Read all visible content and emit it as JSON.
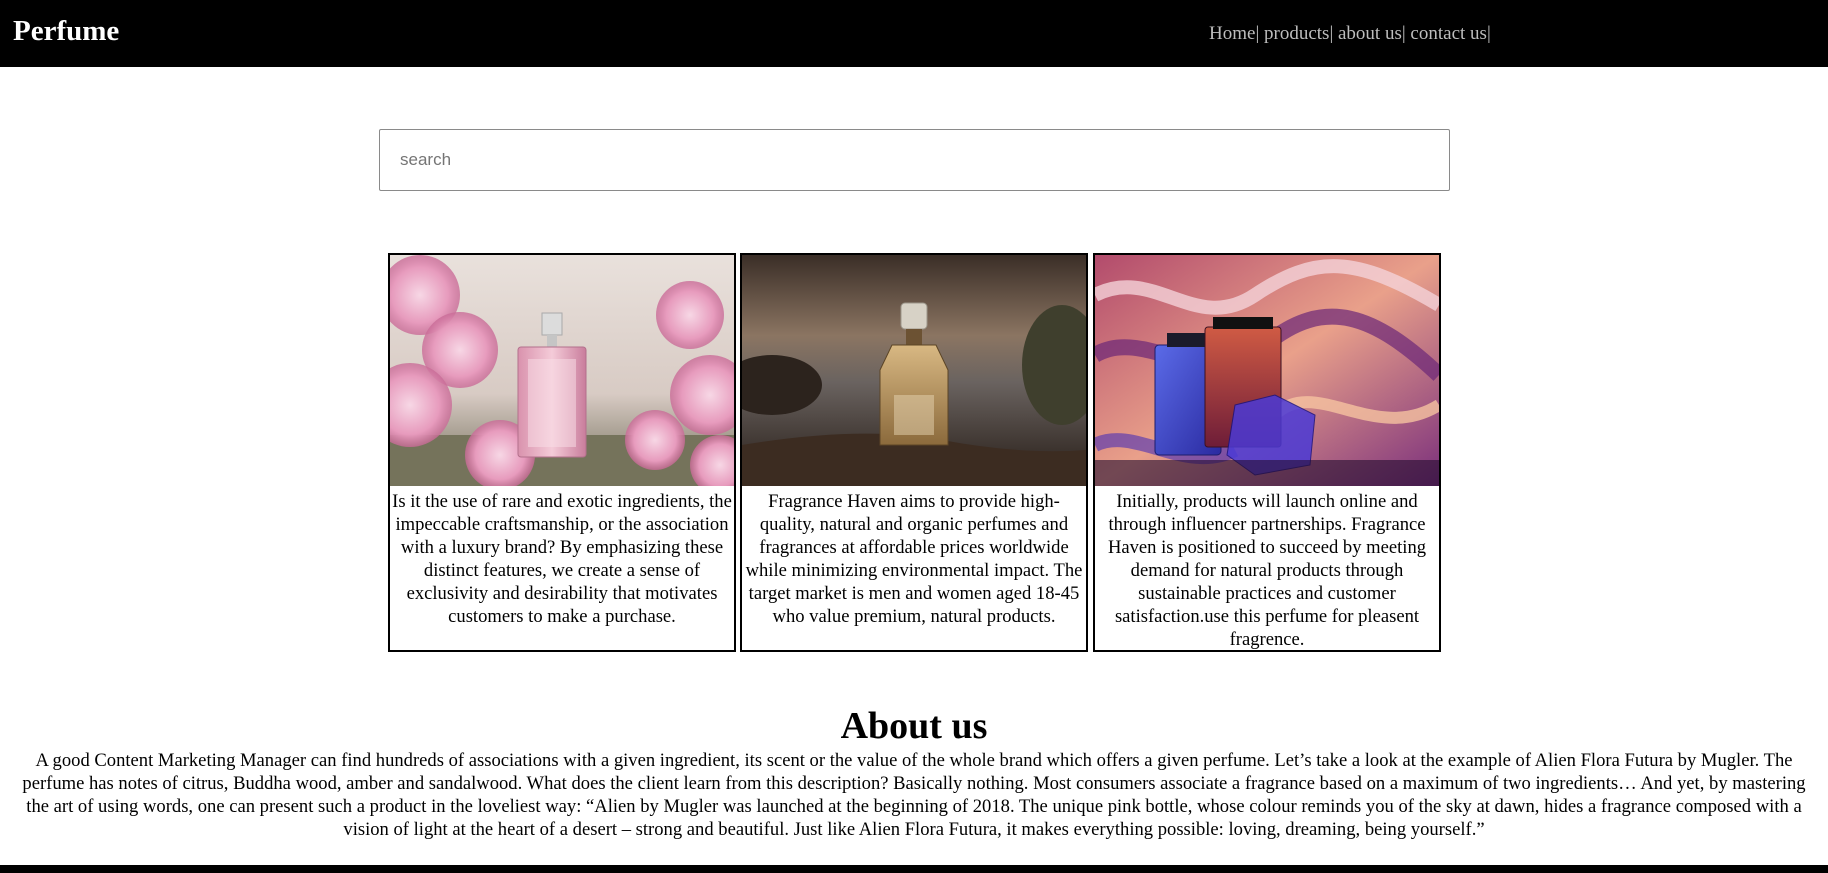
{
  "header": {
    "brand": "Perfume",
    "nav": [
      {
        "label": "Home",
        "sep": "|"
      },
      {
        "label": " products",
        "sep": "|"
      },
      {
        "label": " about us",
        "sep": "|"
      },
      {
        "label": " contact us",
        "sep": "|"
      }
    ]
  },
  "search": {
    "placeholder": "search",
    "value": ""
  },
  "cards": [
    {
      "image": "pink-perfume-bottle-with-blossoms",
      "text": "Is it the use of rare and exotic ingredients, the impeccable craftsmanship, or the association with a luxury brand? By emphasizing these distinct features, we create a sense of exclusivity and desirability that motivates customers to make a purchase."
    },
    {
      "image": "amber-perfume-bottle-on-rock",
      "text": "Fragrance Haven aims to provide high-quality, natural and organic perfumes and fragrances at affordable prices worldwide while minimizing environmental impact. The target market is men and women aged 18-45 who value premium, natural products."
    },
    {
      "image": "perfume-bottles-on-swirl-background",
      "text": "Initially, products will launch online and through influencer partnerships. Fragrance Haven is positioned to succeed by meeting demand for natural products through sustainable practices and customer satisfaction.use this perfume for pleasent fragrence."
    }
  ],
  "about": {
    "title": "About us",
    "text": "A good Content Marketing Manager can find hundreds of associations with a given ingredient, its scent or the value of the whole brand which offers a given perfume. Let’s take a look at the example of Alien Flora Futura by Mugler. The perfume has notes of citrus, Buddha wood, amber and sandalwood. What does the client learn from this description? Basically nothing. Most consumers associate a fragrance based on a maximum of two ingredients… And yet, by mastering the art of using words, one can present such a product in the loveliest way: “Alien by Mugler was launched at the beginning of 2018. The unique pink bottle, whose colour reminds you of the sky at dawn, hides a fragrance composed with a vision of light at the heart of a desert – strong and beautiful. Just like Alien Flora Futura, it makes everything possible: loving, dreaming, being yourself.”"
  },
  "colors": {
    "navbar": "#000000",
    "brand_text": "#ffffff",
    "nav_text": "#bdbdbd"
  }
}
